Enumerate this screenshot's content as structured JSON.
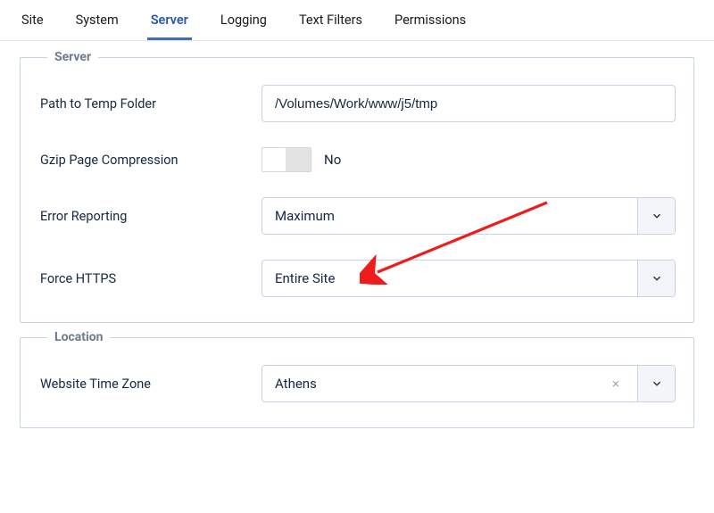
{
  "tabs": {
    "site": "Site",
    "system": "System",
    "server": "Server",
    "logging": "Logging",
    "text_filters": "Text Filters",
    "permissions": "Permissions"
  },
  "server_section": {
    "legend": "Server",
    "path_label": "Path to Temp Folder",
    "path_value": "/Volumes/Work/www/j5/tmp",
    "gzip_label": "Gzip Page Compression",
    "gzip_value": "No",
    "error_label": "Error Reporting",
    "error_value": "Maximum",
    "https_label": "Force HTTPS",
    "https_value": "Entire Site"
  },
  "location_section": {
    "legend": "Location",
    "tz_label": "Website Time Zone",
    "tz_value": "Athens",
    "clear": "×"
  }
}
